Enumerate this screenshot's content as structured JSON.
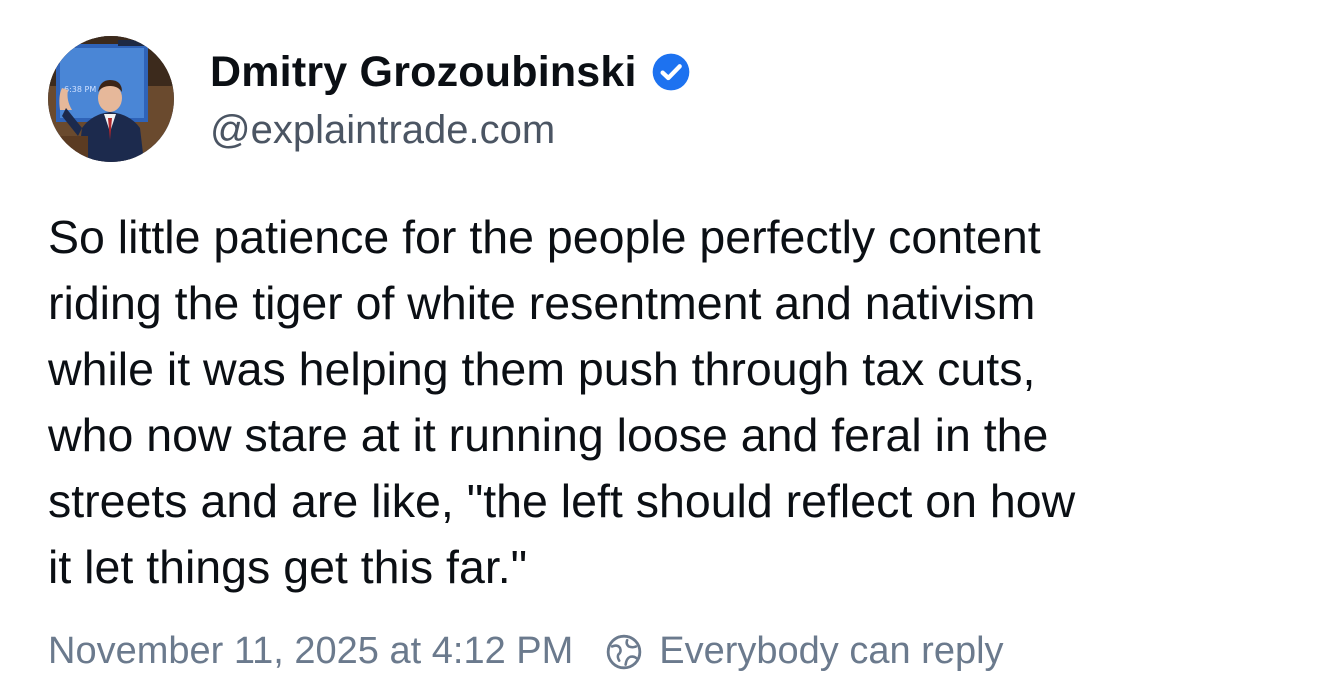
{
  "author": {
    "display_name": "Dmitry Grozoubinski",
    "handle": "@explaintrade.com",
    "verified": true,
    "verified_icon": "verified-check-icon",
    "verified_color": "#1d9bf0",
    "avatar_alt": "profile photo"
  },
  "post": {
    "text": "So little patience for the people perfectly content\nriding the tiger of white resentment and nativism\nwhile it was helping them push through tax cuts,\nwho now stare at it running loose and feral in the\nstreets and are like, \"the left should reflect on how\nit let things get this far.\""
  },
  "meta": {
    "timestamp": "November 11, 2025 at 4:12 PM",
    "reply_setting_icon": "globe-icon",
    "reply_setting": "Everybody can reply"
  },
  "colors": {
    "text": "#0b0f14",
    "secondary_text": "#4b5563",
    "meta_text": "#6b7a8d"
  }
}
